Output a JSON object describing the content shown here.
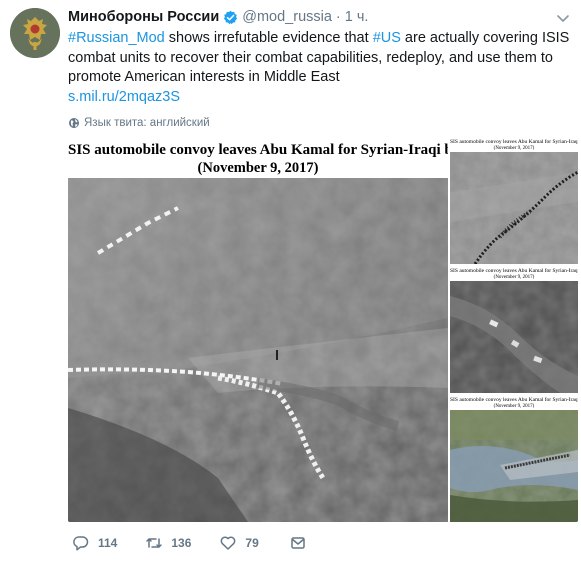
{
  "author": {
    "display_name": "Минобороны России",
    "handle": "@mod_russia",
    "separator": "·",
    "time": "1 ч."
  },
  "tweet": {
    "line1": [
      "#Russian_Mod",
      " shows irrefutable evidence that ",
      "#US",
      " are actually covering ISIS"
    ],
    "line2": "combat units to recover their combat capabilities, redeploy, and use them to",
    "line3": "promote American interests in Middle East",
    "url": "s.mil.ru/2mqaz3S"
  },
  "translate_label": "Язык твита: английский",
  "media": {
    "main_caption_1": "SIS automobile convoy leaves Abu Kamal for Syrian-Iraqi borde",
    "main_caption_2": "(November 9, 2017)",
    "side_caption_1": "SIS automobile convoy leaves Abu Kamal for Syrian-Iraqi borde",
    "side_caption_2": "(November 9, 2017)"
  },
  "actions": {
    "reply_count": "114",
    "retweet_count": "136",
    "like_count": "79"
  },
  "colors": {
    "link": "#1b95e0",
    "secondary_text": "#657786",
    "verified": "#1da1f2"
  },
  "icons": [
    "verified-badge-icon",
    "chevron-down-icon",
    "globe-icon",
    "reply-icon",
    "retweet-icon",
    "like-icon",
    "direct-message-icon"
  ]
}
